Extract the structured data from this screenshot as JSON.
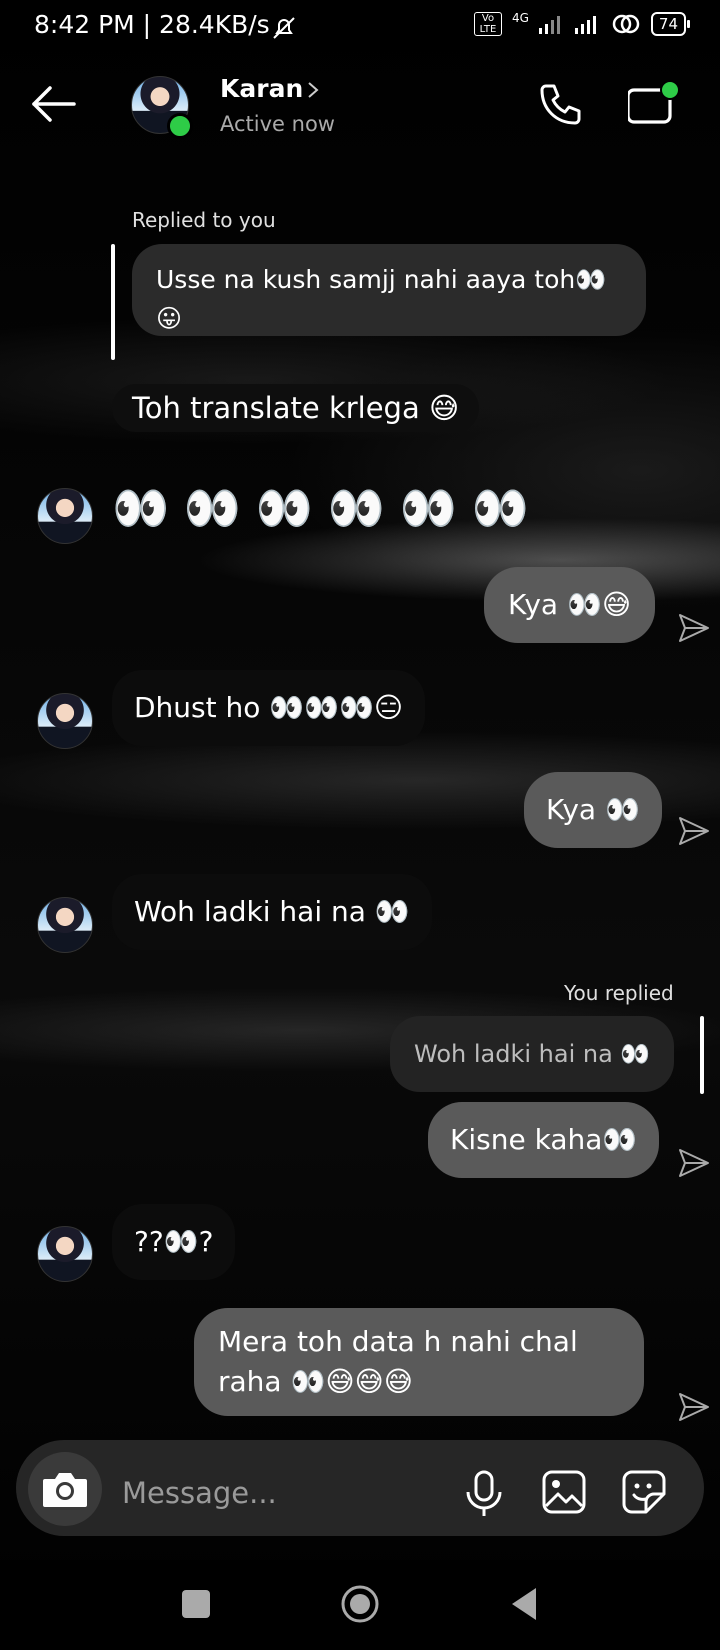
{
  "status_bar": {
    "time": "8:42 PM | 28.4KB/s",
    "network_label": "4G",
    "volte": "Vo LTE",
    "battery": "74"
  },
  "header": {
    "name": "Karan",
    "status": "Active now"
  },
  "messages": {
    "reply_label_1": "Replied to you",
    "quoted_1": "Usse na kush samjj nahi aaya toh👀 😛",
    "m1": "Toh translate krlega 😅",
    "m2": "👀 👀 👀 👀 👀 👀",
    "m3": "Kya 👀😅",
    "m4": "Dhust ho 👀👀👀😑",
    "m5": "Kya 👀",
    "m6": "Woh ladki hai na 👀",
    "reply_label_2": "You replied",
    "quoted_2": "Woh ladki hai na 👀",
    "m7": "Kisne kaha👀",
    "m8": "??👀?",
    "m9": "Mera toh data h nahi chal raha 👀😅😅😅"
  },
  "composer": {
    "placeholder": "Message..."
  },
  "colors": {
    "online": "#2ecc47",
    "incoming_bubble": "#262626",
    "outgoing_bubble": "#5a5a5a"
  }
}
